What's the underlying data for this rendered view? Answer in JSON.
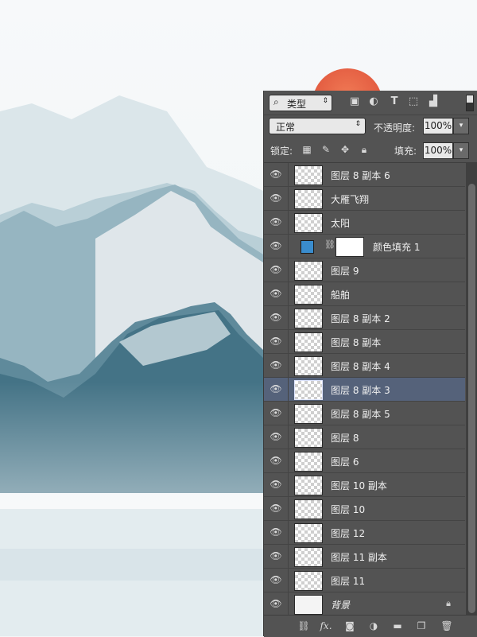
{
  "panel": {
    "filter": {
      "label": "类型",
      "icons": [
        "image-filter-icon",
        "adjustment-filter-icon",
        "type-filter-icon",
        "shape-filter-icon",
        "smart-object-filter-icon"
      ]
    },
    "blend_mode": "正常",
    "opacity_label": "不透明度:",
    "opacity_value": "100%",
    "lock_label": "锁定:",
    "lock_icons": [
      "lock-transparent-pixels-icon",
      "lock-image-pixels-icon",
      "lock-position-icon",
      "lock-all-icon"
    ],
    "fill_label": "填充:",
    "fill_value": "100%",
    "layers": [
      {
        "name": "图层 8 副本 6",
        "type": "pixel"
      },
      {
        "name": "大雁飞翔",
        "type": "pixel"
      },
      {
        "name": "太阳",
        "type": "pixel"
      },
      {
        "name": "颜色填充 1",
        "type": "fill",
        "fill_color": "#3a8ccd"
      },
      {
        "name": "图层 9",
        "type": "pixel"
      },
      {
        "name": "船舶",
        "type": "pixel"
      },
      {
        "name": "图层 8 副本 2",
        "type": "pixel"
      },
      {
        "name": "图层 8 副本",
        "type": "pixel"
      },
      {
        "name": "图层 8 副本 4",
        "type": "pixel"
      },
      {
        "name": "图层 8 副本 3",
        "type": "pixel",
        "selected": true
      },
      {
        "name": "图层 8 副本 5",
        "type": "pixel"
      },
      {
        "name": "图层 8",
        "type": "pixel"
      },
      {
        "name": "图层 6",
        "type": "pixel"
      },
      {
        "name": "图层 10 副本",
        "type": "pixel"
      },
      {
        "name": "图层 10",
        "type": "pixel"
      },
      {
        "name": "图层 12",
        "type": "pixel"
      },
      {
        "name": "图层 11 副本",
        "type": "pixel"
      },
      {
        "name": "图层 11",
        "type": "pixel"
      },
      {
        "name": "背景",
        "type": "background",
        "locked": true
      }
    ],
    "bottom_icons": [
      "link-layers-icon",
      "fx-icon",
      "add-mask-icon",
      "new-adjustment-icon",
      "new-group-icon",
      "new-layer-icon",
      "trash-icon"
    ],
    "bottom_fx_text": "fx."
  },
  "colors": {
    "panel_bg": "#535353",
    "selected_row": "#55627a",
    "sun": "#e86a4a"
  }
}
